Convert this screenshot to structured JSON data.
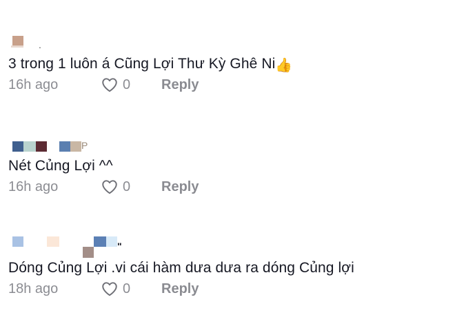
{
  "comments": [
    {
      "text": "3 trong 1 luôn á Cũng Lợi Thư Kỳ Ghê Ni",
      "emoji": "👍",
      "time": "16h ago",
      "likes": "0",
      "reply_label": "Reply"
    },
    {
      "text": "Nét Củng Lợi ^^",
      "time": "16h ago",
      "likes": "0",
      "reply_label": "Reply"
    },
    {
      "text": "Dóng Củng Lợi .vi cái hàm dưa dưa ra dóng Củng lợi",
      "time": "18h ago",
      "likes": "0",
      "reply_label": "Reply"
    }
  ],
  "icons": {
    "like": "heart-outline-icon"
  },
  "colors": {
    "text": "#161823",
    "muted": "rgba(22,24,35,0.5)",
    "background": "#ffffff",
    "emoji": "#f2b01e"
  }
}
